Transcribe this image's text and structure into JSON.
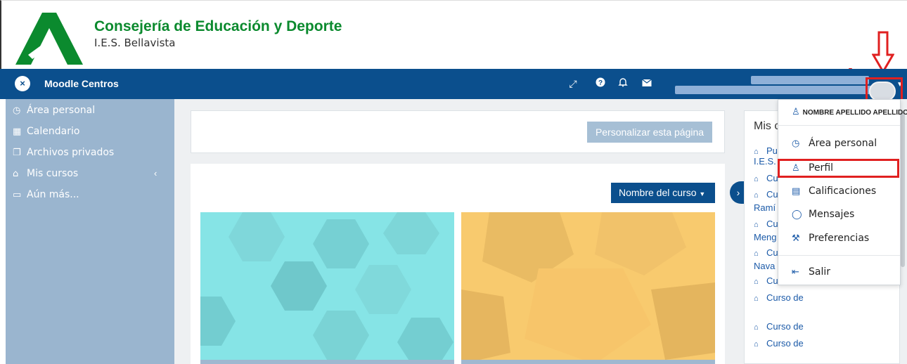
{
  "header": {
    "title": "Consejería de Educación y Deporte",
    "subtitle": "I.E.S. Bellavista"
  },
  "navbar": {
    "close_icon": "×",
    "brand": "Moodle Centros",
    "icons": [
      "expand-icon",
      "help-icon",
      "bell-icon",
      "envelope-icon"
    ]
  },
  "sidebar": {
    "items": [
      {
        "label": "Área personal",
        "icon": "dashboard-icon"
      },
      {
        "label": "Calendario",
        "icon": "calendar-icon"
      },
      {
        "label": "Archivos privados",
        "icon": "files-icon"
      },
      {
        "label": "Mis cursos",
        "icon": "graduation-cap-icon"
      },
      {
        "label": "Aún más...",
        "icon": "folder-icon"
      }
    ]
  },
  "main": {
    "customise_button": "Personalizar esta página",
    "sort_button": "Nombre del curso"
  },
  "right_block": {
    "title": "Mis c",
    "links": [
      {
        "text": "Pu"
      },
      {
        "text": "Cu"
      },
      {
        "text": "Cu"
      },
      {
        "text": "Cu"
      },
      {
        "text": "Cu"
      },
      {
        "text": "Cu"
      },
      {
        "text": "Curso de"
      },
      {
        "text": "Curso de"
      },
      {
        "text": "Curso de"
      }
    ],
    "continuations": [
      "I.E.S. B",
      "Ramí",
      "Meng",
      "Nava"
    ]
  },
  "dropdown": {
    "user_name": "NOMBRE APELLIDO APELLIDO",
    "items": [
      {
        "label": "Área personal",
        "icon": "dashboard-icon"
      },
      {
        "label": "Perfil",
        "icon": "user-icon"
      },
      {
        "label": "Calificaciones",
        "icon": "grades-icon"
      },
      {
        "label": "Mensajes",
        "icon": "message-icon"
      },
      {
        "label": "Preferencias",
        "icon": "wrench-icon"
      },
      {
        "label": "Salir",
        "icon": "logout-icon"
      }
    ]
  },
  "colors": {
    "navbar": "#0b4f8d",
    "sidebar": "#9ab5cf",
    "title_green": "#0b8a2e",
    "highlight_red": "#e02020",
    "course_teal": "#7fe0e0",
    "course_yellow": "#f6c766"
  }
}
